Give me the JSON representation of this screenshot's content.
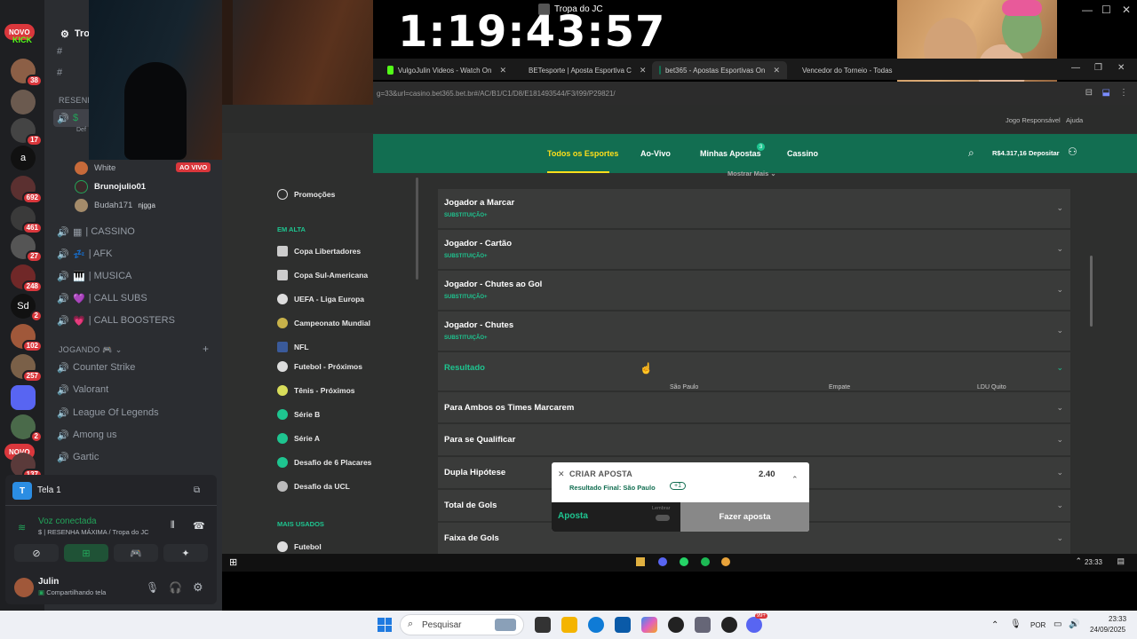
{
  "discord": {
    "rail": {
      "novo_label": "NOVO",
      "kick_label": "KICK",
      "servers": [
        {
          "badge": "38"
        },
        {
          "badge": ""
        },
        {
          "badge": "17"
        },
        {
          "initial": "a"
        },
        {
          "badge": "692"
        },
        {
          "badge": "461"
        },
        {
          "badge": "27"
        },
        {
          "badge": "248"
        },
        {
          "initial": "Sd",
          "badge": "2"
        },
        {
          "badge": "102"
        },
        {
          "badge": "257"
        },
        {
          "badge": ""
        },
        {
          "badge": "2"
        },
        {
          "badge": "137"
        }
      ]
    },
    "header": {
      "server_name": "Tro"
    },
    "section_resenha": "RESENH",
    "default_label": "Def",
    "members": [
      {
        "name": "White",
        "tag": "",
        "live": "AO VIVO"
      },
      {
        "name": "Brunojulio01",
        "tag": "",
        "live": ""
      },
      {
        "name": "Budah171",
        "tag": "njgga",
        "live": ""
      }
    ],
    "channels_top": [
      "| CASSINO",
      "| AFK",
      "| MUSICA",
      "| CALL SUBS",
      "| CALL BOOSTERS"
    ],
    "category_jogando": "JOGANDO 🎮",
    "channels_games": [
      "Counter Strike",
      "Valorant",
      "League Of Legends",
      "Among us",
      "Gartic"
    ],
    "screen_share": {
      "title": "Tela 1"
    },
    "voice": {
      "status": "Voz conectada",
      "channel": "| RESENHA MÁXIMA / Tropa do JC"
    },
    "user": {
      "name": "Julin",
      "status": "Compartilhando tela"
    }
  },
  "stream": {
    "title": "Tropa do JC",
    "timer": "1:19:43:57"
  },
  "browser": {
    "tabs": [
      {
        "label": "VulgoJulin Videos - Watch On",
        "color": "#53fc18"
      },
      {
        "label": "BETesporte | Aposta Esportiva C",
        "color": "#1d6bd6"
      },
      {
        "label": "bet365 - Apostas Esportivas On",
        "color": "#126e51",
        "active": true
      },
      {
        "label": "Vencedor do Torneio - Todas",
        "color": "#d32f2f"
      }
    ],
    "url": "g=33&url=casino.bet365.bet.br#/AC/B1/C1/D8/E181493544/F3/I99/P29821/"
  },
  "bet365": {
    "top_links": [
      "Jogo Responsável",
      "Ajuda"
    ],
    "nav": [
      "Todos os Esportes",
      "Ao-Vivo",
      "Minhas Apostas",
      "Cassino"
    ],
    "nav_badge": "3",
    "balance": "R$4.317,16",
    "deposit": "Depositar",
    "left_nav": {
      "promo": "Promoções",
      "em_alta_header": "EM ALTA",
      "em_alta": [
        "Copa Libertadores",
        "Copa Sul-Americana",
        "UEFA - Liga Europa",
        "Campeonato Mundial",
        "NFL",
        "Futebol - Próximos",
        "Tênis - Próximos",
        "Série B",
        "Série A",
        "Desafio de 6 Placares",
        "Desafio da UCL"
      ],
      "mais_usados_header": "MAIS USADOS",
      "mais_usados": [
        "Futebol"
      ]
    },
    "mostrar_mais": "Mostrar Mais",
    "markets": [
      {
        "title": "Jogador a Marcar",
        "sub": "SUBSTITUIÇÃO+"
      },
      {
        "title": "Jogador - Cartão",
        "sub": "SUBSTITUIÇÃO+"
      },
      {
        "title": "Jogador - Chutes ao Gol",
        "sub": "SUBSTITUIÇÃO+"
      },
      {
        "title": "Jogador - Chutes",
        "sub": "SUBSTITUIÇÃO+"
      },
      {
        "title": "Resultado",
        "sub": ""
      },
      {
        "title": "Para Ambos os Times Marcarem",
        "sub": ""
      },
      {
        "title": "Para se Qualificar",
        "sub": ""
      },
      {
        "title": "Dupla Hipótese",
        "sub": ""
      },
      {
        "title": "Total de Gols",
        "sub": ""
      },
      {
        "title": "Faixa de Gols",
        "sub": ""
      }
    ],
    "result_cols": [
      "São Paulo",
      "Empate",
      "LDU Quito"
    ],
    "betslip": {
      "title": "CRIAR APOSTA",
      "odds": "2.40",
      "selection": "Resultado Final: São Paulo",
      "extra": "+1",
      "stake_label": "Aposta",
      "lembrar": "Lembrar",
      "place": "Fazer aposta"
    }
  },
  "inner_taskbar": {
    "time": "23:33"
  },
  "taskbar": {
    "search": "Pesquisar",
    "lang": "POR",
    "time": "23:33",
    "date": "24/09/2025",
    "notif": "99+"
  }
}
